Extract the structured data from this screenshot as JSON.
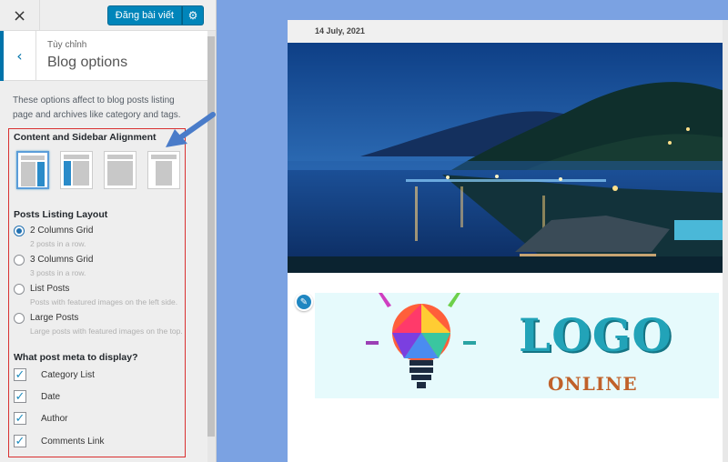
{
  "topbar": {
    "publish_label": "Đăng bài viết",
    "close_icon": "×",
    "gear_icon": "⚙"
  },
  "section": {
    "breadcrumb": "Tùy chỉnh",
    "title": "Blog options",
    "back_icon": "‹"
  },
  "description": "These options affect to blog posts listing page and archives like category and tags.",
  "alignment": {
    "label": "Content and Sidebar Alignment",
    "options": [
      "right-sidebar",
      "left-sidebar",
      "no-sidebar",
      "full-width"
    ],
    "selected_index": 0
  },
  "layout": {
    "label": "Posts Listing Layout",
    "options": [
      {
        "label": "2 Columns Grid",
        "hint": "2 posts in a row.",
        "checked": true
      },
      {
        "label": "3 Columns Grid",
        "hint": "3 posts in a row.",
        "checked": false
      },
      {
        "label": "List Posts",
        "hint": "Posts with featured images on the left side.",
        "checked": false
      },
      {
        "label": "Large Posts",
        "hint": "Large posts with featured images on the top.",
        "checked": false
      }
    ]
  },
  "meta": {
    "label": "What post meta to display?",
    "options": [
      {
        "label": "Category List",
        "checked": true
      },
      {
        "label": "Date",
        "checked": true
      },
      {
        "label": "Author",
        "checked": true
      },
      {
        "label": "Comments Link",
        "checked": true
      }
    ],
    "check_icon": "✓"
  },
  "preview": {
    "date": "14 July, 2021",
    "edit_icon": "✎",
    "logo_text": "LOGO",
    "logo_sub": "ONLINE"
  },
  "colors": {
    "accent": "#0085ba",
    "highlight_border": "#d93030",
    "arrow": "#4a7cc9"
  }
}
